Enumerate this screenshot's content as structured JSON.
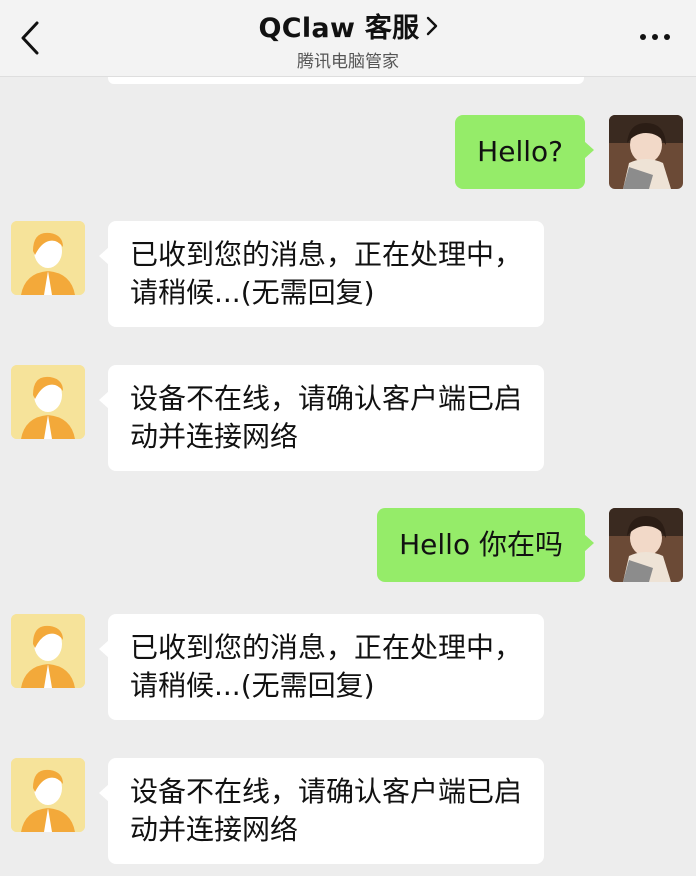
{
  "header": {
    "title": "QClaw 客服",
    "subtitle": "腾讯电脑管家",
    "back_icon": "chevron-left-icon",
    "title_chevron_icon": "chevron-right-icon",
    "more_icon": "more-dots-icon"
  },
  "colors": {
    "outgoing_bubble": "#95ec69",
    "incoming_bubble": "#ffffff",
    "background": "#ededed"
  },
  "messages": [
    {
      "from": "me",
      "text": "Hello?"
    },
    {
      "from": "bot",
      "lines": [
        "已收到您的消息，正在处理中，",
        "请稍候...(无需回复)"
      ]
    },
    {
      "from": "bot",
      "lines": [
        "设备不在线，请确认客户端已启",
        "动并连接网络"
      ]
    },
    {
      "from": "me",
      "text": "Hello 你在吗"
    },
    {
      "from": "bot",
      "lines": [
        "已收到您的消息，正在处理中，",
        "请稍候...(无需回复)"
      ]
    },
    {
      "from": "bot",
      "lines": [
        "设备不在线，请确认客户端已启",
        "动并连接网络"
      ]
    }
  ]
}
